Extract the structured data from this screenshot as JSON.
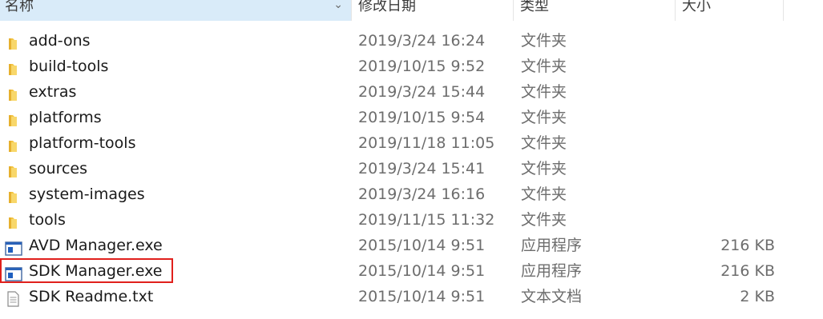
{
  "columns": {
    "name": "名称",
    "date": "修改日期",
    "type": "类型",
    "size": "大小"
  },
  "files": [
    {
      "name": "add-ons",
      "date": "2019/3/24 16:24",
      "type": "文件夹",
      "size": "",
      "icon": "folder-icon"
    },
    {
      "name": "build-tools",
      "date": "2019/10/15 9:52",
      "type": "文件夹",
      "size": "",
      "icon": "folder-icon"
    },
    {
      "name": "extras",
      "date": "2019/3/24 15:44",
      "type": "文件夹",
      "size": "",
      "icon": "folder-icon"
    },
    {
      "name": "platforms",
      "date": "2019/10/15 9:54",
      "type": "文件夹",
      "size": "",
      "icon": "folder-icon"
    },
    {
      "name": "platform-tools",
      "date": "2019/11/18 11:05",
      "type": "文件夹",
      "size": "",
      "icon": "folder-icon"
    },
    {
      "name": "sources",
      "date": "2019/3/24 15:41",
      "type": "文件夹",
      "size": "",
      "icon": "folder-icon"
    },
    {
      "name": "system-images",
      "date": "2019/3/24 16:16",
      "type": "文件夹",
      "size": "",
      "icon": "folder-icon"
    },
    {
      "name": "tools",
      "date": "2019/11/15 11:32",
      "type": "文件夹",
      "size": "",
      "icon": "folder-icon"
    },
    {
      "name": "AVD Manager.exe",
      "date": "2015/10/14 9:51",
      "type": "应用程序",
      "size": "216 KB",
      "icon": "application-icon"
    },
    {
      "name": "SDK Manager.exe",
      "date": "2015/10/14 9:51",
      "type": "应用程序",
      "size": "216 KB",
      "icon": "application-icon"
    },
    {
      "name": "SDK Readme.txt",
      "date": "2015/10/14 9:51",
      "type": "文本文档",
      "size": "2 KB",
      "icon": "text-document-icon"
    }
  ],
  "colors": {
    "header_selected_bg": "#d9ebf9",
    "folder": "#f4c542",
    "highlight": "#e0201c"
  }
}
